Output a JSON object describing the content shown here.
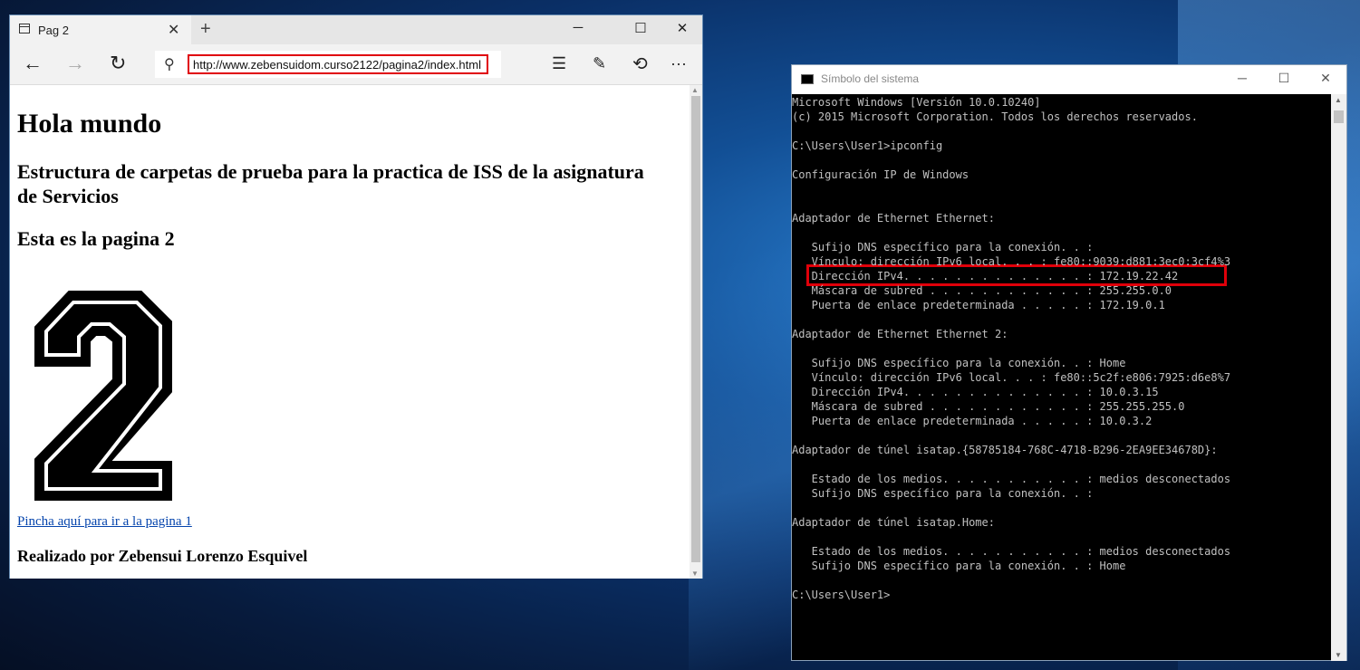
{
  "browser": {
    "tab_title": "Pag 2",
    "tab_close": "✕",
    "new_tab": "+",
    "minimize": "─",
    "maximize": "☐",
    "close": "✕",
    "back": "←",
    "forward": "→",
    "refresh": "↻",
    "search_glyph": "⚲",
    "url": "http://www.zebensuidom.curso2122/pagina2/index.html",
    "hub": "☰",
    "note": "✎",
    "share": "⟲",
    "more": "···",
    "accent_highlight": "#e0000a"
  },
  "page": {
    "heading": "Hola mundo",
    "subheading": "Estructura de carpetas de prueba para la practica de ISS de la asignatura de Servicios",
    "page_label": "Esta es la pagina 2",
    "number_image_glyph": "2",
    "link_text": "Pincha aquí para ir a la pagina 1",
    "footer": "Realizado por Zebensui Lorenzo Esquivel"
  },
  "cmd": {
    "title": "Símbolo del sistema",
    "minimize": "─",
    "maximize": "☐",
    "close": "✕",
    "lines": [
      "Microsoft Windows [Versión 10.0.10240]",
      "(c) 2015 Microsoft Corporation. Todos los derechos reservados.",
      "",
      "C:\\Users\\User1>ipconfig",
      "",
      "Configuración IP de Windows",
      "",
      "",
      "Adaptador de Ethernet Ethernet:",
      "",
      "   Sufijo DNS específico para la conexión. . :",
      "   Vínculo: dirección IPv6 local. . . : fe80::9039:d881:3ec0:3cf4%3",
      "   Dirección IPv4. . . . . . . . . . . . . . : 172.19.22.42",
      "   Máscara de subred . . . . . . . . . . . . : 255.255.0.0",
      "   Puerta de enlace predeterminada . . . . . : 172.19.0.1",
      "",
      "Adaptador de Ethernet Ethernet 2:",
      "",
      "   Sufijo DNS específico para la conexión. . : Home",
      "   Vínculo: dirección IPv6 local. . . : fe80::5c2f:e806:7925:d6e8%7",
      "   Dirección IPv4. . . . . . . . . . . . . . : 10.0.3.15",
      "   Máscara de subred . . . . . . . . . . . . : 255.255.255.0",
      "   Puerta de enlace predeterminada . . . . . : 10.0.3.2",
      "",
      "Adaptador de túnel isatap.{58785184-768C-4718-B296-2EA9EE34678D}:",
      "",
      "   Estado de los medios. . . . . . . . . . . : medios desconectados",
      "   Sufijo DNS específico para la conexión. . :",
      "",
      "Adaptador de túnel isatap.Home:",
      "",
      "   Estado de los medios. . . . . . . . . . . : medios desconectados",
      "   Sufijo DNS específico para la conexión. . : Home",
      "",
      "C:\\Users\\User1>"
    ]
  }
}
